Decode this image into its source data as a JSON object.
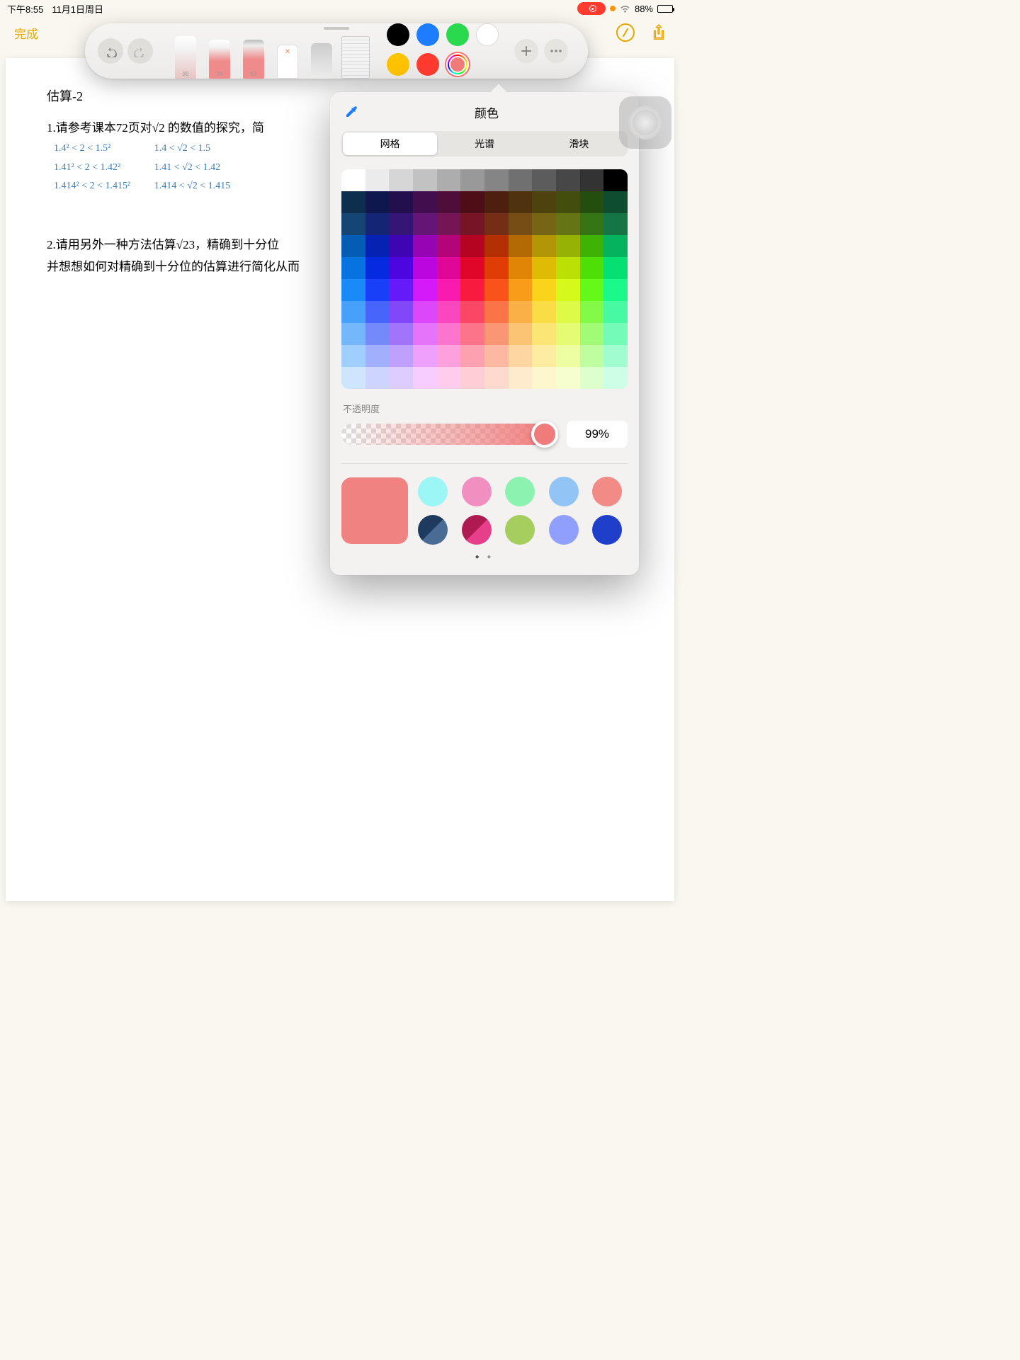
{
  "statusbar": {
    "time": "下午8:55",
    "date": "11月1日周日",
    "battery_pct": "88%"
  },
  "header": {
    "done": "完成"
  },
  "doc": {
    "title": "估算-2",
    "q1": "1.请参考课本72页对√2 的数值的探究，简",
    "hw": {
      "left": [
        "1.4² < 2 < 1.5²",
        "1.41² < 2 < 1.42²",
        "1.414² < 2 < 1.415²"
      ],
      "right": [
        "1.4 < √2 < 1.5",
        "1.41 < √2 < 1.42",
        "1.414 < √2 < 1.415"
      ]
    },
    "q2a": "2.请用另外一种方法估算√23，精确到十分位",
    "q2b": "并想想如何对精确到十分位的估算进行简化从而"
  },
  "tooltray": {
    "pen_label": "99",
    "hl_label": "34",
    "pencil_label": "53",
    "swatch_colors": [
      "#000000",
      "#1e7cff",
      "#2bd94f",
      "#ffffff",
      "#ffc300",
      "#ff3b30"
    ]
  },
  "popover": {
    "title": "颜色",
    "tabs": [
      "网格",
      "光谱",
      "滑块"
    ],
    "opacity_label": "不透明度",
    "opacity_value": "99%",
    "current_color": "#f08282",
    "presets": [
      "#9cf6f5",
      "#f18fc1",
      "#8cf2b0",
      "#92c4f6",
      "#f28a86",
      "#1f3a5f|#4a6b93",
      "#b01a52|#e83f8a",
      "#a5ce5e",
      "#8f9ffb",
      "#1f3fca"
    ]
  }
}
